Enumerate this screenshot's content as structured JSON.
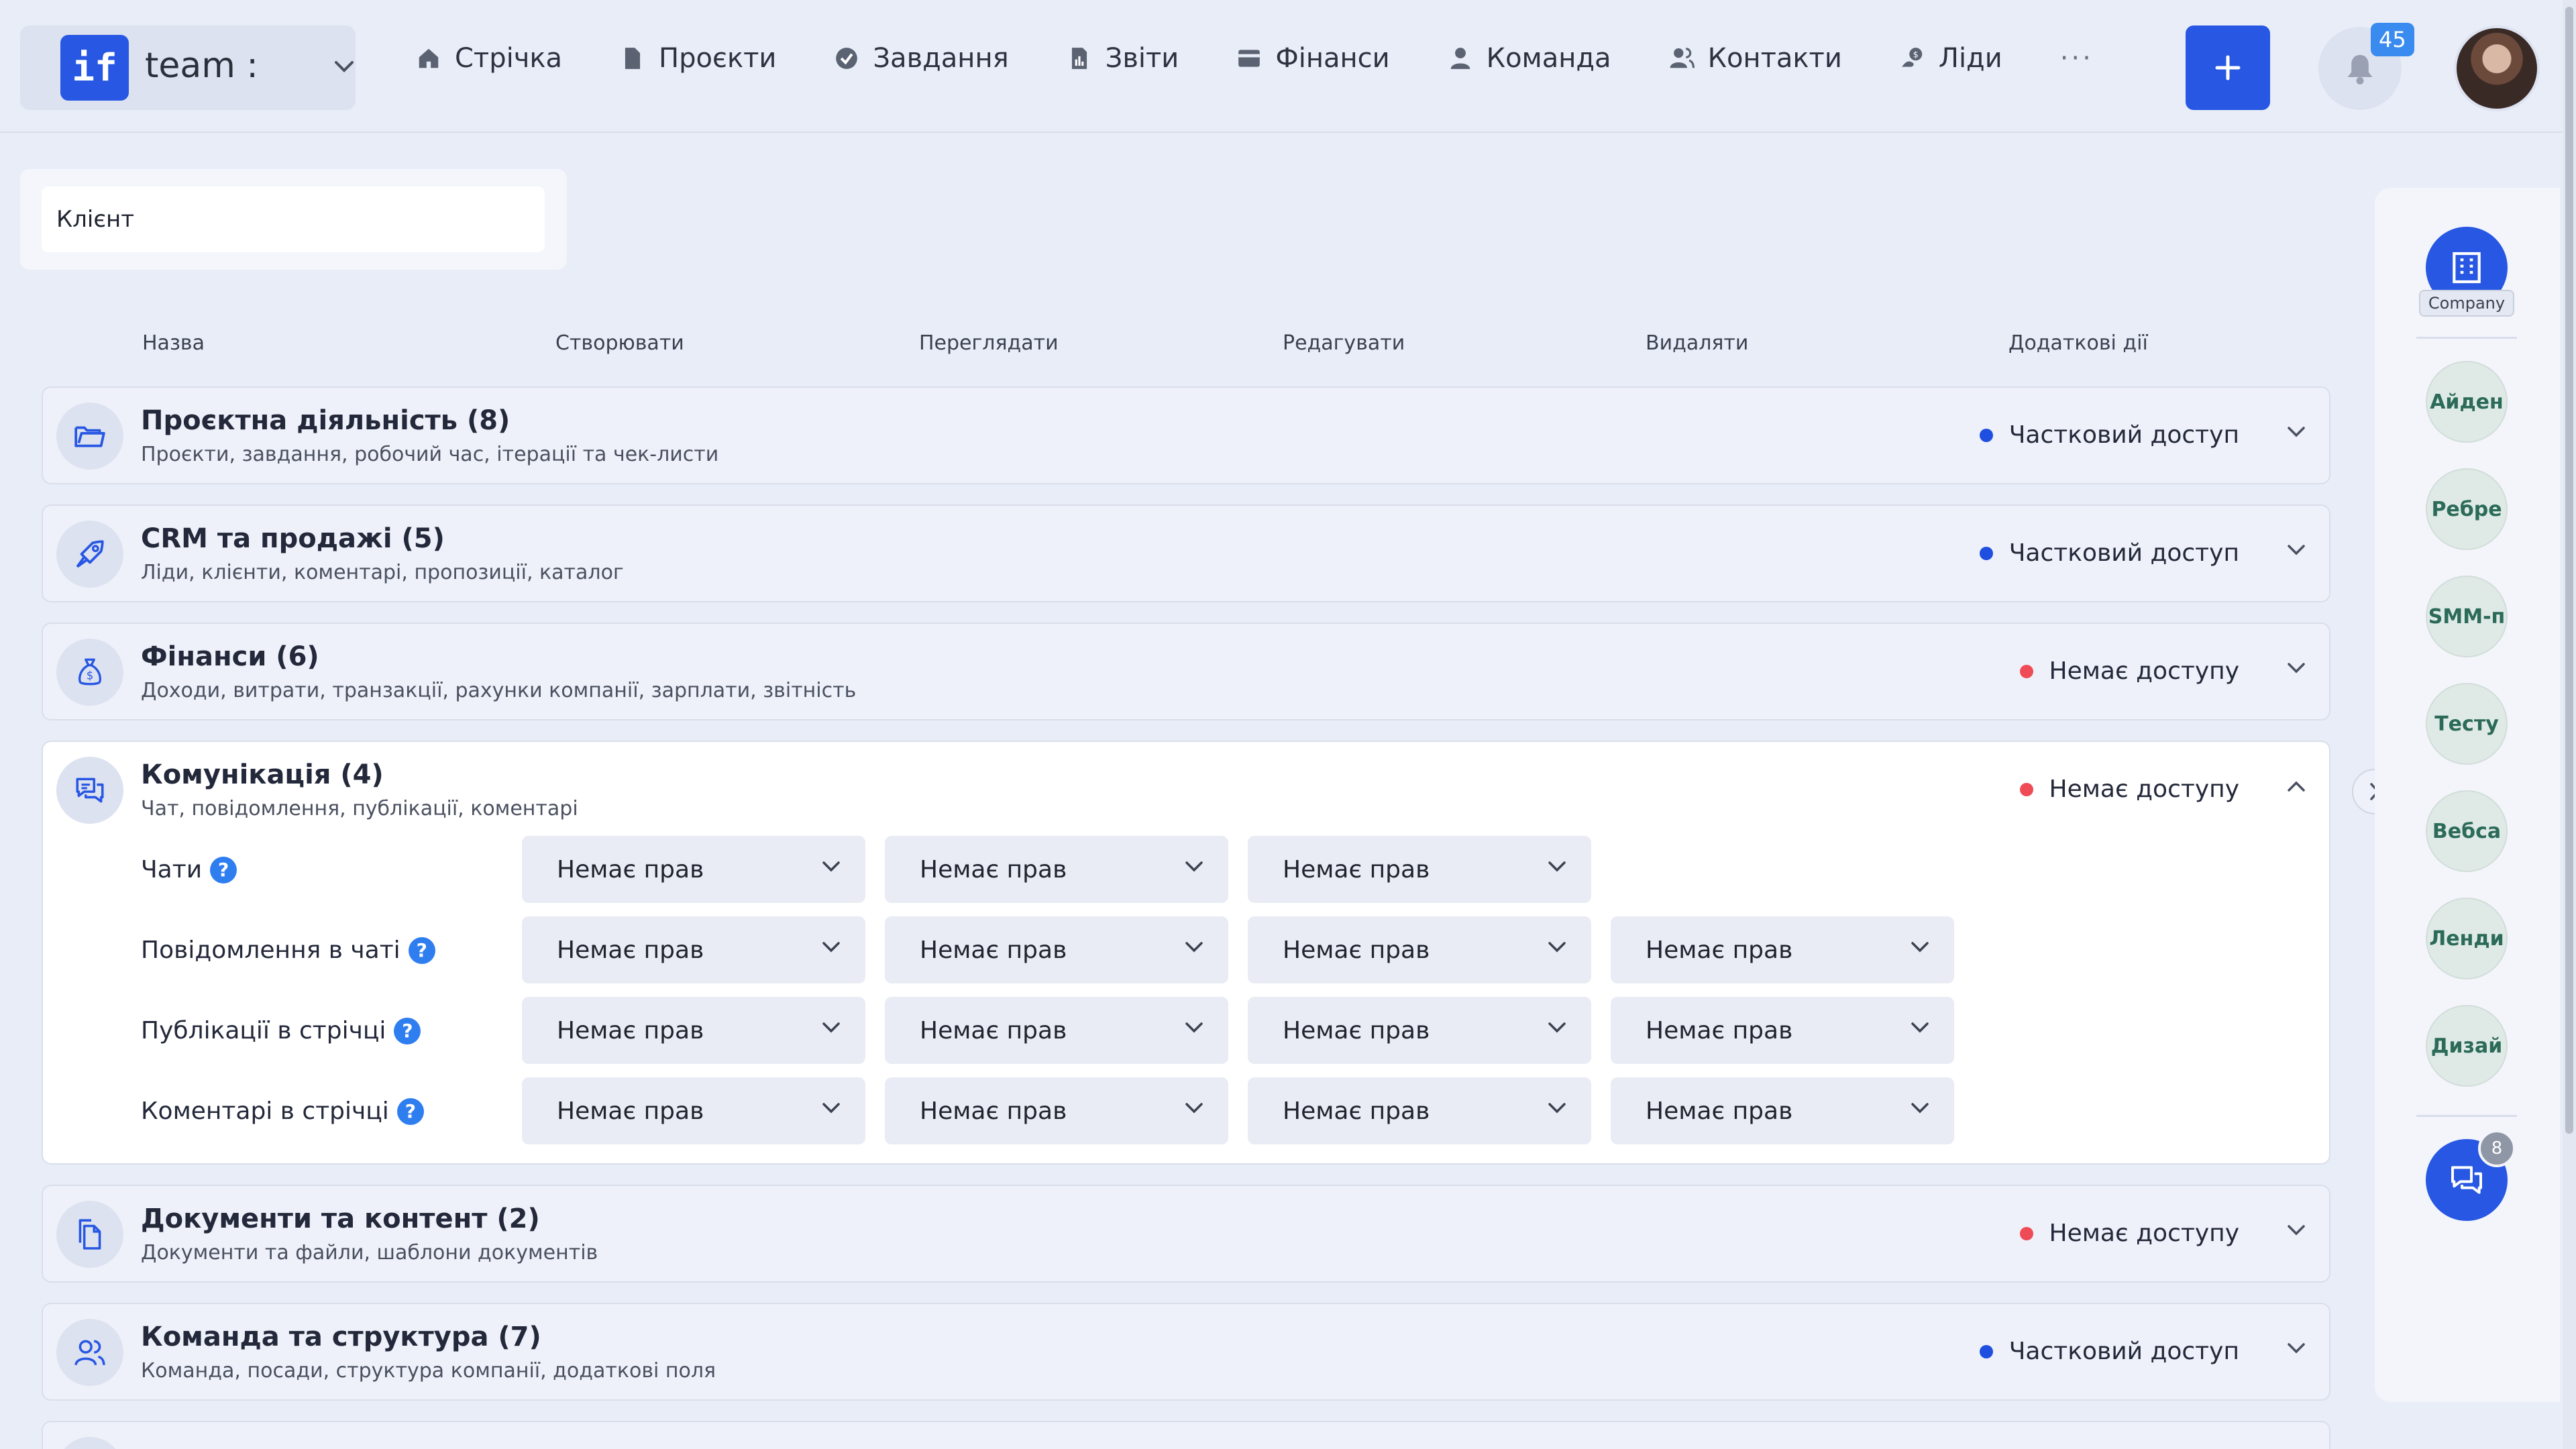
{
  "header": {
    "logo_text": "if",
    "workspace_name": "team :",
    "nav": [
      {
        "label": "Стрічка",
        "icon": "home-icon"
      },
      {
        "label": "Проєкти",
        "icon": "document-icon"
      },
      {
        "label": "Завдання",
        "icon": "check-circle-icon"
      },
      {
        "label": "Звіти",
        "icon": "report-icon"
      },
      {
        "label": "Фінанси",
        "icon": "wallet-icon"
      },
      {
        "label": "Команда",
        "icon": "user-icon"
      },
      {
        "label": "Контакти",
        "icon": "contacts-icon"
      },
      {
        "label": "Ліди",
        "icon": "leads-icon"
      }
    ],
    "more_label": "···",
    "notifications_count": "45"
  },
  "filter": {
    "value": "Клієнт"
  },
  "columns": {
    "name": "Назва",
    "create": "Створювати",
    "view": "Переглядати",
    "edit": "Редагувати",
    "delete": "Видаляти",
    "extra": "Додаткові дії"
  },
  "modules": [
    {
      "title": "Проєктна діяльність (8)",
      "subtitle": "Проєкти, завдання, робочий час, ітерації та чек-листи",
      "status": "Частковий доступ",
      "status_color": "#1f4fe0",
      "icon": "folder-icon"
    },
    {
      "title": "CRM та продажі (5)",
      "subtitle": "Ліди, клієнти, коментарі, пропозиції, каталог",
      "status": "Частковий доступ",
      "status_color": "#1f4fe0",
      "icon": "rocket-icon"
    },
    {
      "title": "Фінанси (6)",
      "subtitle": "Доходи, витрати, транзакції, рахунки компанії, зарплати, звітність",
      "status": "Немає доступу",
      "status_color": "#ef4b57",
      "icon": "money-bag-icon"
    },
    {
      "title": "Комунікація (4)",
      "subtitle": "Чат, повідомлення, публікації, коментарі",
      "status": "Немає доступу",
      "status_color": "#ef4b57",
      "icon": "chat-icon",
      "permissions": [
        {
          "label": "Чати",
          "values": [
            "Немає прав",
            "Немає прав",
            "Немає прав"
          ]
        },
        {
          "label": "Повідомлення в чаті",
          "values": [
            "Немає прав",
            "Немає прав",
            "Немає прав",
            "Немає прав"
          ]
        },
        {
          "label": "Публікації в стрічці",
          "values": [
            "Немає прав",
            "Немає прав",
            "Немає прав",
            "Немає прав"
          ]
        },
        {
          "label": "Коментарі в стрічці",
          "values": [
            "Немає прав",
            "Немає прав",
            "Немає прав",
            "Немає прав"
          ]
        }
      ]
    },
    {
      "title": "Документи та контент (2)",
      "subtitle": "Документи та файли, шаблони документів",
      "status": "Немає доступу",
      "status_color": "#ef4b57",
      "icon": "documents-icon"
    },
    {
      "title": "Команда та структура (7)",
      "subtitle": "Команда, посади, структура компанії, додаткові поля",
      "status": "Частковий доступ",
      "status_color": "#1f4fe0",
      "icon": "team-icon"
    }
  ],
  "help_glyph": "?",
  "sidebar": {
    "company_label": "Company",
    "members": [
      "Айден",
      "Ребре",
      "SMM-п",
      "Тесту",
      "Вебса",
      "Ленди",
      "Дизай"
    ],
    "chat_badge": "8"
  },
  "colors": {
    "accent": "#2757e3",
    "partial": "#1f4fe0",
    "none": "#ef4b57"
  }
}
